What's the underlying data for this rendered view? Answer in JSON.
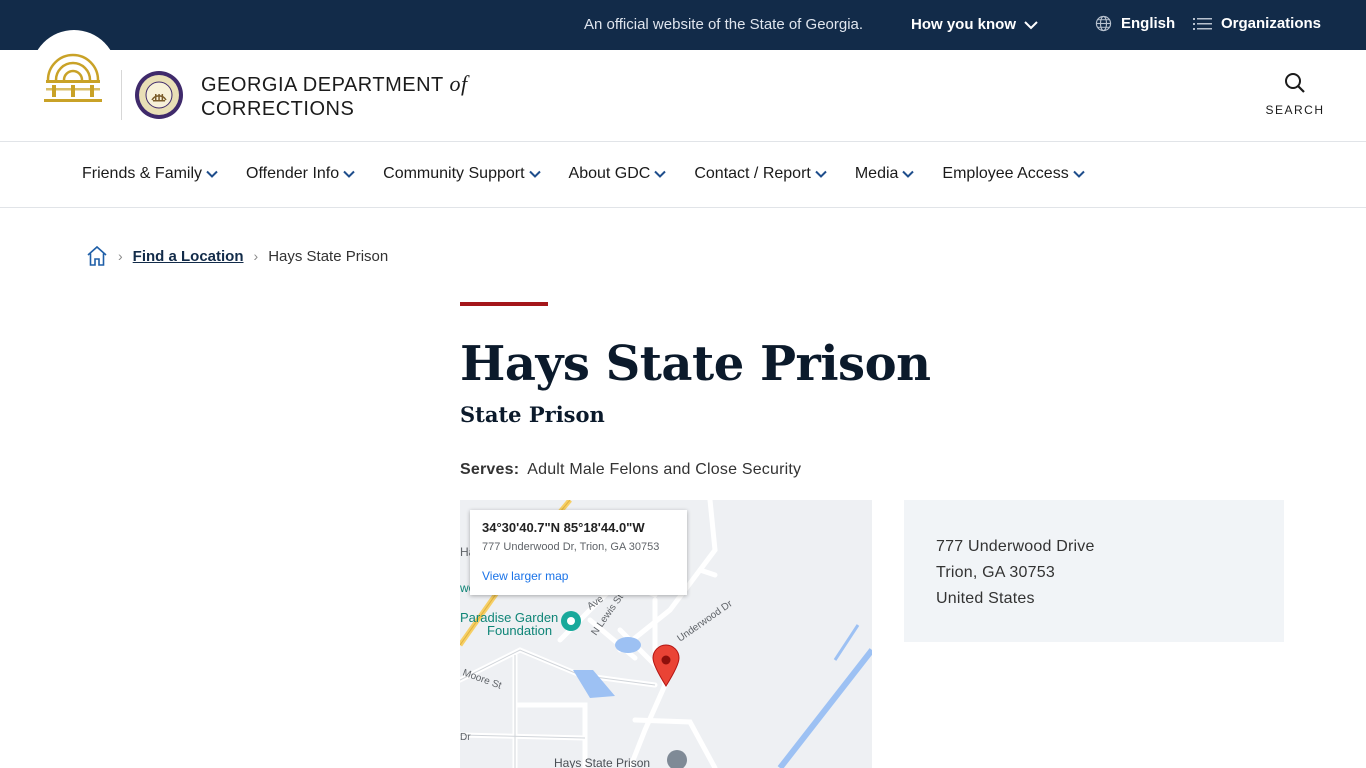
{
  "banner": {
    "official_text": "An official website of the State of Georgia.",
    "how_you_know": "How you know",
    "language": "English",
    "organizations": "Organizations"
  },
  "header": {
    "agency_line1": "GEORGIA DEPARTMENT",
    "agency_of": "of",
    "agency_line2": "CORRECTIONS",
    "search_label": "SEARCH"
  },
  "nav": {
    "items": [
      {
        "label": "Friends & Family"
      },
      {
        "label": "Offender Info"
      },
      {
        "label": "Community Support"
      },
      {
        "label": "About GDC"
      },
      {
        "label": "Contact / Report"
      },
      {
        "label": "Media"
      },
      {
        "label": "Employee Access"
      }
    ]
  },
  "breadcrumb": {
    "parent": "Find a Location",
    "current": "Hays State Prison"
  },
  "page": {
    "title": "Hays State Prison",
    "subtitle": "State Prison",
    "serves_label": "Serves:",
    "serves_value": "Adult Male Felons and Close Security"
  },
  "map": {
    "coordinates": "34°30'40.7\"N 85°18'44.0\"W",
    "address": "777 Underwood Dr, Trion, GA 30753",
    "view_larger": "View larger map",
    "labels": {
      "paradise_1": "Paradise Garden",
      "paradise_2": "Foundation",
      "hays": "Hays State Prison",
      "n_lewis": "N Lewis St",
      "underwood": "Underwood Dr",
      "moore": "Moore St",
      "ave": "Ave",
      "dr_left": "Dr",
      "ha": "Ha",
      "wo": "wo"
    }
  },
  "address_card": {
    "line1": "777 Underwood Drive",
    "line2": "Trion, GA 30753",
    "line3": "United States"
  },
  "colors": {
    "banner_bg": "#122b49",
    "accent_red": "#a4161a",
    "gold": "#c9a227"
  }
}
